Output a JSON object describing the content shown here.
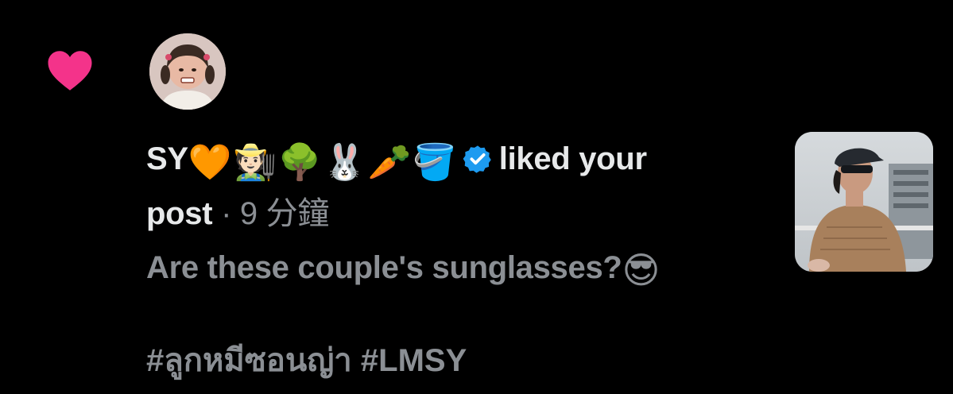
{
  "notification": {
    "type_icon": "heart-icon",
    "accent_color": "#f4338a",
    "avatar_icon": "user-avatar",
    "user": {
      "name": "SY",
      "name_emojis": [
        "🧡",
        "🧑🏻‍🌾",
        "🌳",
        "🐰",
        "🥕",
        "🪣"
      ],
      "verified": true,
      "verified_color": "#1d9bf0"
    },
    "action_text": "liked your post",
    "action_first": "liked your",
    "action_second": "post",
    "separator": "·",
    "time": "9 分鐘",
    "post": {
      "text": "Are these couple's sunglasses?",
      "emoji": "😎",
      "hashtags": "#ลูกหมีซอนญ่า #LMSY"
    },
    "thumbnail": "post-photo-thumbnail"
  }
}
